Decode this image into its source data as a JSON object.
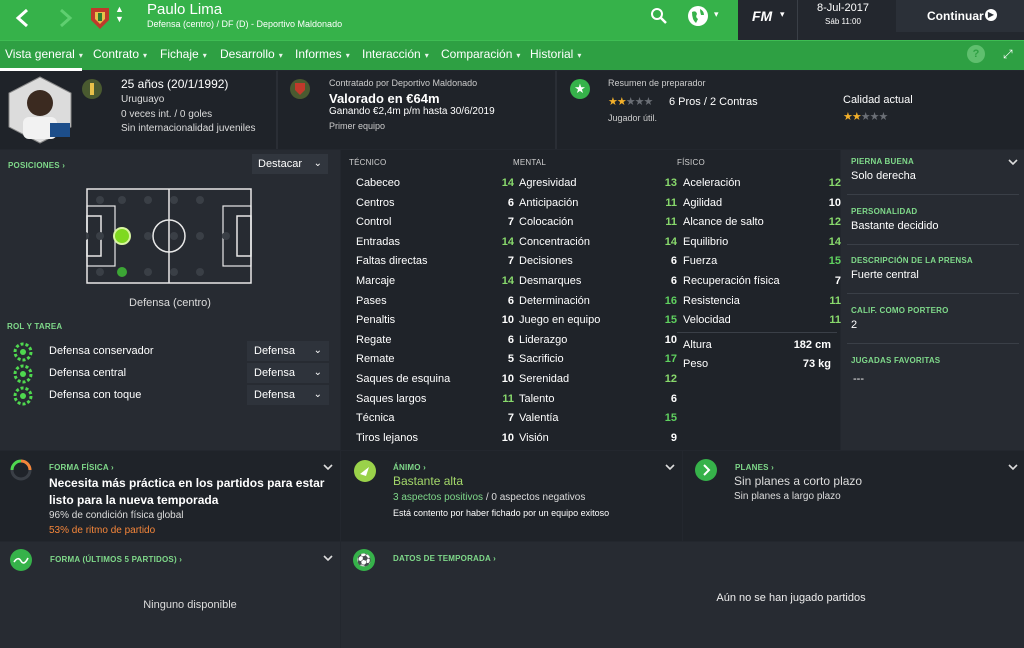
{
  "header": {
    "player_name": "Paulo Lima",
    "subtitle": "Defensa (centro) / DF (D) - Deportivo Maldonado",
    "date": "8-Jul-2017",
    "day_time": "Sáb 11:00",
    "continue_label": "Continuar",
    "fm_logo": "FM"
  },
  "tabs": [
    {
      "label": "Vista general"
    },
    {
      "label": "Contrato"
    },
    {
      "label": "Fichaje"
    },
    {
      "label": "Desarrollo"
    },
    {
      "label": "Informes"
    },
    {
      "label": "Interacción"
    },
    {
      "label": "Comparación"
    },
    {
      "label": "Historial"
    }
  ],
  "help_label": "?",
  "bio": {
    "age": "25 años (20/1/1992)",
    "nation": "Uruguayo",
    "caps": "0 veces int. / 0 goles",
    "youth": "Sin internacionalidad juveniles"
  },
  "contract": {
    "line1": "Contratado por Deportivo Maldonado",
    "value": "Valorado en €64m",
    "wage": "Ganando €2,4m p/m hasta 30/6/2019",
    "squad": "Primer equipo"
  },
  "coach": {
    "title": "Resumen de preparador",
    "pros_cons": "6 Pros / 2 Contras",
    "summary": "Jugador útil.",
    "current_ability_label": "Calidad actual",
    "coach_stars": 2,
    "ability_stars": 2
  },
  "positions": {
    "title": "POSICIONES",
    "highlight_dropdown": "Destacar",
    "position_name": "Defensa (centro)"
  },
  "roles": {
    "title": "ROL Y TAREA",
    "items": [
      {
        "name": "Defensa conservador",
        "duty": "Defensa"
      },
      {
        "name": "Defensa central",
        "duty": "Defensa"
      },
      {
        "name": "Defensa con toque",
        "duty": "Defensa"
      }
    ]
  },
  "attributes": {
    "technical_title": "TÉCNICO",
    "mental_title": "MENTAL",
    "physical_title": "FÍSICO",
    "technical": [
      {
        "name": "Cabeceo",
        "value": "14"
      },
      {
        "name": "Centros",
        "value": "6"
      },
      {
        "name": "Control",
        "value": "7"
      },
      {
        "name": "Entradas",
        "value": "14"
      },
      {
        "name": "Faltas directas",
        "value": "7"
      },
      {
        "name": "Marcaje",
        "value": "14"
      },
      {
        "name": "Pases",
        "value": "6"
      },
      {
        "name": "Penaltis",
        "value": "10"
      },
      {
        "name": "Regate",
        "value": "6"
      },
      {
        "name": "Remate",
        "value": "5"
      },
      {
        "name": "Saques de esquina",
        "value": "10"
      },
      {
        "name": "Saques largos",
        "value": "11"
      },
      {
        "name": "Técnica",
        "value": "7"
      },
      {
        "name": "Tiros lejanos",
        "value": "10"
      }
    ],
    "mental": [
      {
        "name": "Agresividad",
        "value": "13"
      },
      {
        "name": "Anticipación",
        "value": "11"
      },
      {
        "name": "Colocación",
        "value": "11"
      },
      {
        "name": "Concentración",
        "value": "14"
      },
      {
        "name": "Decisiones",
        "value": "6"
      },
      {
        "name": "Desmarques",
        "value": "6"
      },
      {
        "name": "Determinación",
        "value": "16"
      },
      {
        "name": "Juego en equipo",
        "value": "15"
      },
      {
        "name": "Liderazgo",
        "value": "10"
      },
      {
        "name": "Sacrificio",
        "value": "17"
      },
      {
        "name": "Serenidad",
        "value": "12"
      },
      {
        "name": "Talento",
        "value": "6"
      },
      {
        "name": "Valentía",
        "value": "15"
      },
      {
        "name": "Visión",
        "value": "9"
      }
    ],
    "physical": [
      {
        "name": "Aceleración",
        "value": "12"
      },
      {
        "name": "Agilidad",
        "value": "10"
      },
      {
        "name": "Alcance de salto",
        "value": "12"
      },
      {
        "name": "Equilibrio",
        "value": "14"
      },
      {
        "name": "Fuerza",
        "value": "15"
      },
      {
        "name": "Recuperación física",
        "value": "7"
      },
      {
        "name": "Resistencia",
        "value": "11"
      },
      {
        "name": "Velocidad",
        "value": "11"
      }
    ],
    "height_label": "Altura",
    "height": "182 cm",
    "weight_label": "Peso",
    "weight": "73 kg"
  },
  "side": {
    "foot_title": "PIERNA BUENA",
    "foot": "Solo derecha",
    "personality_title": "PERSONALIDAD",
    "personality": "Bastante decidido",
    "media_title": "DESCRIPCIÓN DE LA PRENSA",
    "media": "Fuerte central",
    "gk_title": "CALIF. COMO PORTERO",
    "gk": "2",
    "pptm_title": "JUGADAS FAVORITAS",
    "pptm": "---"
  },
  "fitness": {
    "title": "FORMA FÍSICA",
    "headline": "Necesita más práctica en los partidos para estar listo para la nueva temporada",
    "condition": "96% de condición física global",
    "match": "53% de ritmo de partido"
  },
  "morale": {
    "title": "ÁNIMO",
    "value": "Bastante alta",
    "positives": "3 aspectos positivos",
    "slash": "/",
    "negatives": "0 aspectos negativos",
    "reason": "Está contento por haber fichado por un equipo exitoso"
  },
  "plans": {
    "title": "PLANES",
    "short": "Sin planes a corto plazo",
    "long": "Sin planes a largo plazo"
  },
  "form": {
    "title": "FORMA (ÚLTIMOS 5 PARTIDOS)",
    "empty": "Ninguno disponible"
  },
  "season": {
    "title": "DATOS DE TEMPORADA",
    "empty": "Aún no se han jugado partidos"
  },
  "colors": {
    "accent": "#36b24a",
    "tab_bg": "#2ea043",
    "bg": "#23272e",
    "good": "#88d96c",
    "star": "#f3b02a",
    "orange": "#f5863a"
  }
}
